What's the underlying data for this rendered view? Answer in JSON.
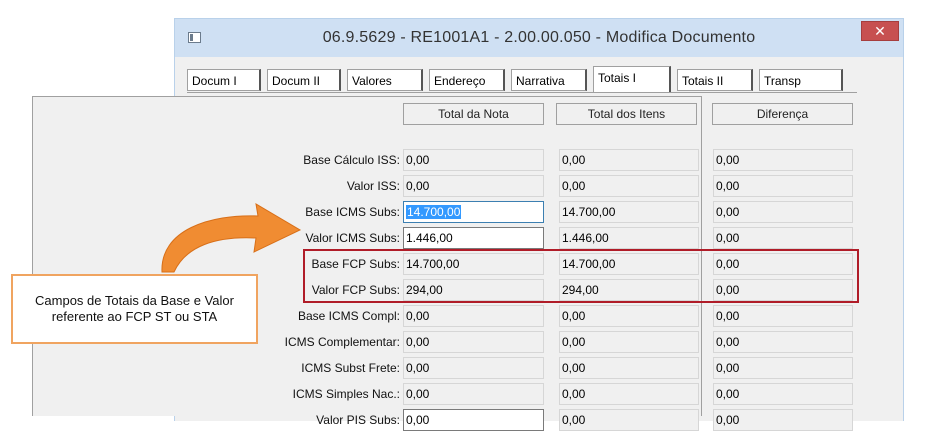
{
  "window": {
    "title": "06.9.5629 - RE1001A1 - 2.00.00.050 - Modifica Documento",
    "close_glyph": "✕"
  },
  "tabs": [
    "Docum I",
    "Docum II",
    "Valores",
    "Endereço",
    "Narrativa",
    "Totais I",
    "Totais II",
    "Transp"
  ],
  "active_tab": "Totais I",
  "columns": [
    "Total da Nota",
    "Total dos Itens",
    "Diferença"
  ],
  "rows": [
    {
      "label": "Base Cálculo ISS:",
      "values": [
        "0,00",
        "0,00",
        "0,00"
      ]
    },
    {
      "label": "Valor ISS:",
      "values": [
        "0,00",
        "0,00",
        "0,00"
      ]
    },
    {
      "label": "Base ICMS Subs:",
      "values": [
        "14.700,00",
        "14.700,00",
        "0,00"
      ]
    },
    {
      "label": "Valor ICMS Subs:",
      "values": [
        "1.446,00",
        "1.446,00",
        "0,00"
      ]
    },
    {
      "label": "Base FCP Subs:",
      "values": [
        "14.700,00",
        "14.700,00",
        "0,00"
      ]
    },
    {
      "label": "Valor FCP Subs:",
      "values": [
        "294,00",
        "294,00",
        "0,00"
      ]
    },
    {
      "label": "Base ICMS Compl:",
      "values": [
        "0,00",
        "0,00",
        "0,00"
      ]
    },
    {
      "label": "ICMS Complementar:",
      "values": [
        "0,00",
        "0,00",
        "0,00"
      ]
    },
    {
      "label": "ICMS Subst Frete:",
      "values": [
        "0,00",
        "0,00",
        "0,00"
      ]
    },
    {
      "label": "ICMS Simples Nac.:",
      "values": [
        "0,00",
        "0,00",
        "0,00"
      ]
    },
    {
      "label": "Valor PIS Subs:",
      "values": [
        "0,00",
        "0,00",
        "0,00"
      ]
    }
  ],
  "callout": {
    "line1": "Campos de Totais da Base e Valor",
    "line2": "referente ao FCP ST ou STA"
  },
  "colors": {
    "highlight": "#b01c28",
    "callout_border": "#f0a460",
    "arrow": "#f08c32"
  }
}
